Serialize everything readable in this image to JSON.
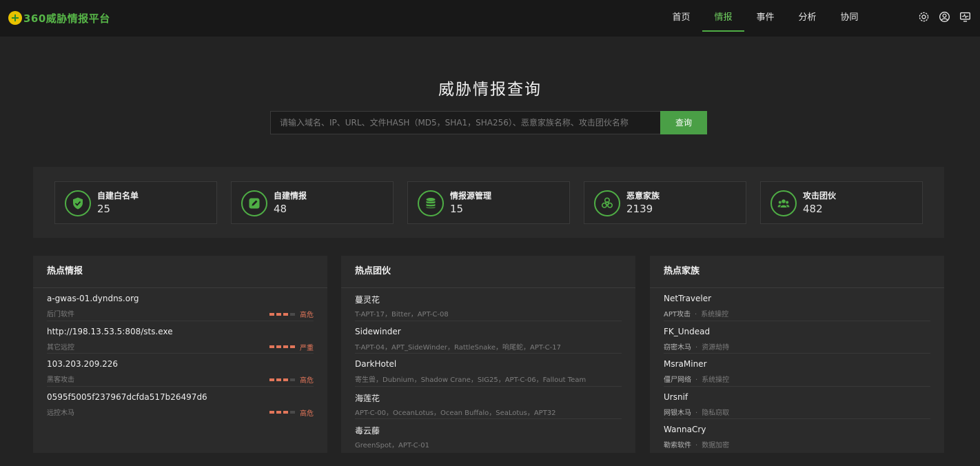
{
  "app": {
    "logo_text": "360威胁情报平台"
  },
  "nav": [
    {
      "label": "首页",
      "active": false
    },
    {
      "label": "情报",
      "active": true
    },
    {
      "label": "事件",
      "active": false
    },
    {
      "label": "分析",
      "active": false
    },
    {
      "label": "协同",
      "active": false
    }
  ],
  "search": {
    "title": "威胁情报查询",
    "placeholder": "请输入域名、IP、URL、文件HASH（MD5，SHA1，SHA256）、恶意家族名称、攻击团伙名称",
    "button": "查询"
  },
  "stats": [
    {
      "label": "自建白名单",
      "value": "25",
      "icon": "shield-check-icon"
    },
    {
      "label": "自建情报",
      "value": "48",
      "icon": "edit-icon"
    },
    {
      "label": "情报源管理",
      "value": "15",
      "icon": "database-icon"
    },
    {
      "label": "恶意家族",
      "value": "2139",
      "icon": "biohazard-icon"
    },
    {
      "label": "攻击团伙",
      "value": "482",
      "icon": "group-icon"
    }
  ],
  "hot_intel": {
    "title": "热点情报",
    "items": [
      {
        "title": "a-gwas-01.dyndns.org",
        "type": "后门软件",
        "level": "高危",
        "bars_filled": 3
      },
      {
        "title": "http://198.13.53.5:808/sts.exe",
        "type": "其它远控",
        "level": "严重",
        "bars_filled": 4
      },
      {
        "title": "103.203.209.226",
        "type": "黑客攻击",
        "level": "高危",
        "bars_filled": 3
      },
      {
        "title": "0595f5005f237967dcfda517b26497d6",
        "type": "远控木马",
        "level": "高危",
        "bars_filled": 3
      }
    ]
  },
  "hot_groups": {
    "title": "热点团伙",
    "items": [
      {
        "title": "蔓灵花",
        "aliases": "T-APT-17，Bitter，APT-C-08"
      },
      {
        "title": "Sidewinder",
        "aliases": "T-APT-04，APT_SideWinder，RattleSnake，响尾蛇，APT-C-17"
      },
      {
        "title": "DarkHotel",
        "aliases": "寄生兽，Dubnium，Shadow Crane，SIG25，APT-C-06，Fallout Team"
      },
      {
        "title": "海莲花",
        "aliases": "APT-C-00，OceanLotus，Ocean Buffalo，SeaLotus，APT32"
      },
      {
        "title": "毒云藤",
        "aliases": "GreenSpot，APT-C-01"
      }
    ]
  },
  "hot_families": {
    "title": "热点家族",
    "separator": "·",
    "items": [
      {
        "title": "NetTraveler",
        "tag1": "APT攻击",
        "tag2": "系统操控"
      },
      {
        "title": "FK_Undead",
        "tag1": "窃密木马",
        "tag2": "资源劫持"
      },
      {
        "title": "MsraMiner",
        "tag1": "僵尸网络",
        "tag2": "系统操控"
      },
      {
        "title": "Ursnif",
        "tag1": "网银木马",
        "tag2": "隐私窃取"
      },
      {
        "title": "WannaCry",
        "tag1": "勒索软件",
        "tag2": "数据加密"
      }
    ]
  },
  "colors": {
    "accent": "#4fae45",
    "danger": "#e2765a",
    "background": "#232323"
  }
}
